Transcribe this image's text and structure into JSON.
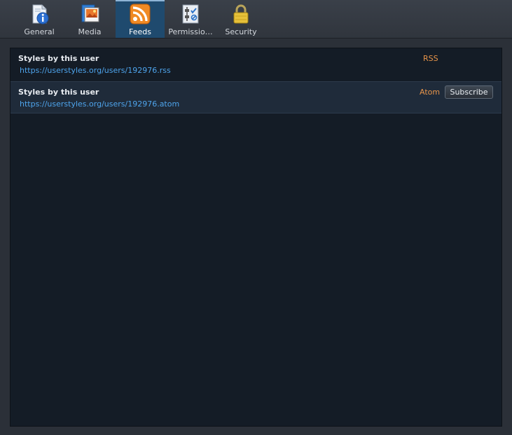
{
  "tabs": [
    {
      "label": "General",
      "icon": "info-page-icon"
    },
    {
      "label": "Media",
      "icon": "media-pictures-icon"
    },
    {
      "label": "Feeds",
      "icon": "rss-feed-icon"
    },
    {
      "label": "Permissio…",
      "icon": "permissions-sliders-icon"
    },
    {
      "label": "Security",
      "icon": "padlock-icon"
    }
  ],
  "active_tab": "Feeds",
  "feeds": [
    {
      "title": "Styles by this user",
      "url": "https://userstyles.org/users/192976.rss",
      "type": "RSS"
    },
    {
      "title": "Styles by this user",
      "url": "https://userstyles.org/users/192976.atom",
      "type": "Atom"
    }
  ],
  "subscribe_label": "Subscribe",
  "colors": {
    "accent": "#1f4a6e",
    "link": "#4ea4ec",
    "feed_type": "#e8954a"
  }
}
